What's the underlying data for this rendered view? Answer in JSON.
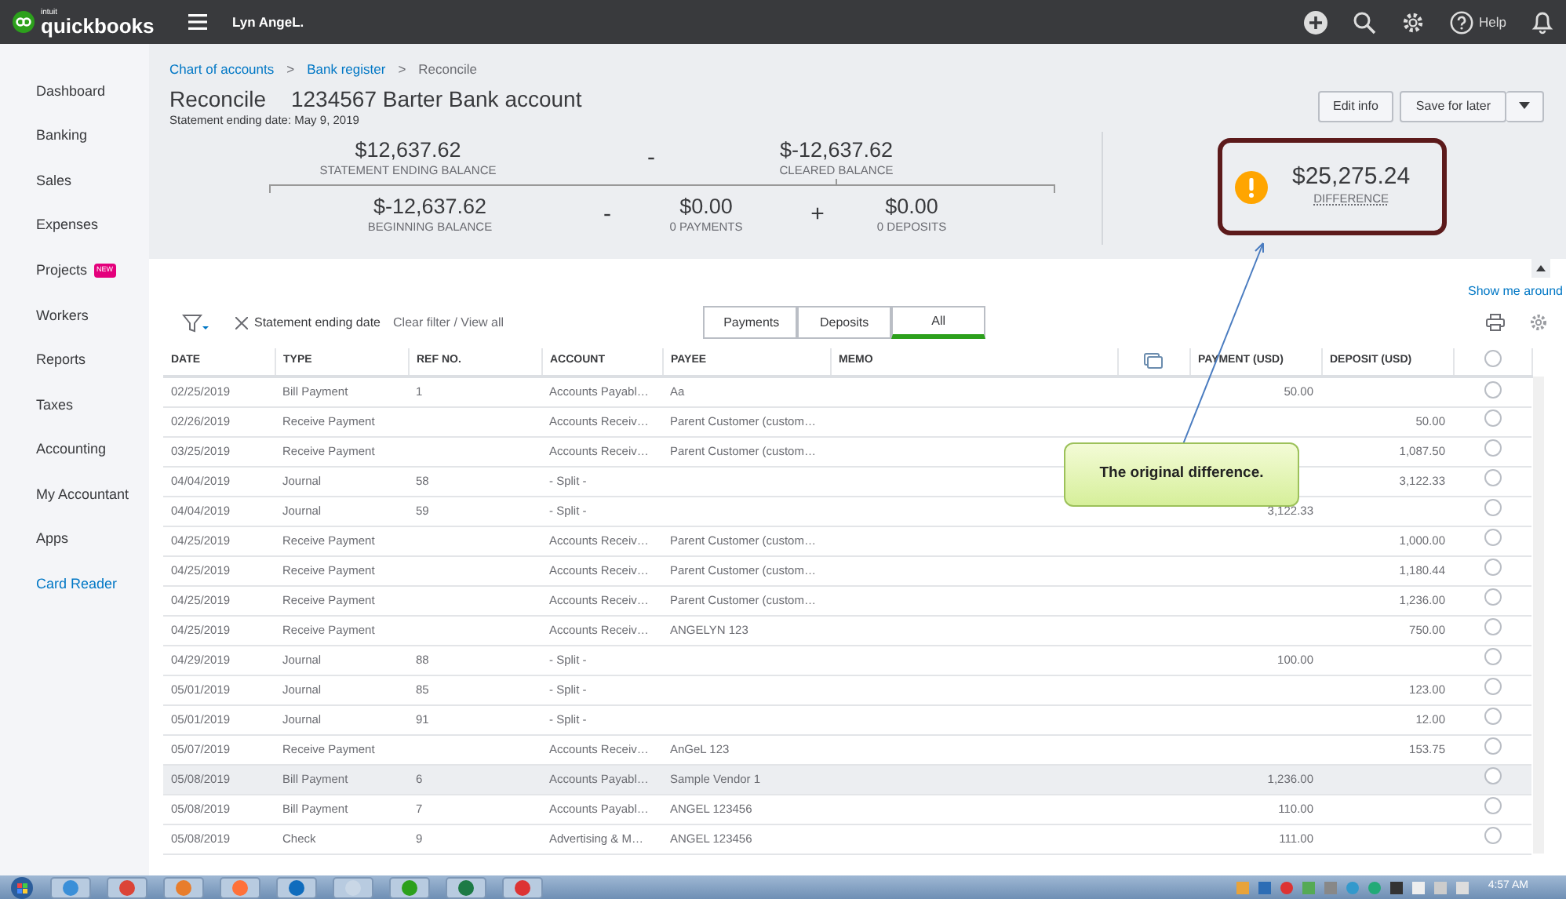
{
  "topbar": {
    "logo_small": "intuit",
    "logo": "quickbooks",
    "company": "Lyn AngeL.",
    "help": "Help"
  },
  "sidebar": {
    "items": [
      {
        "label": "Dashboard",
        "kind": "item"
      },
      {
        "label": "Banking",
        "kind": "item"
      },
      {
        "label": "Sales",
        "kind": "item"
      },
      {
        "label": "Expenses",
        "kind": "item"
      },
      {
        "label": "Projects",
        "kind": "item",
        "badge": "NEW"
      },
      {
        "label": "Workers",
        "kind": "item"
      },
      {
        "label": "Reports",
        "kind": "item"
      },
      {
        "label": "Taxes",
        "kind": "item"
      },
      {
        "label": "Accounting",
        "kind": "item"
      },
      {
        "label": "My Accountant",
        "kind": "item"
      },
      {
        "label": "Apps",
        "kind": "item"
      },
      {
        "label": "Card Reader",
        "kind": "link"
      }
    ]
  },
  "breadcrumb": {
    "separator": ">",
    "items": [
      {
        "label": "Chart of accounts",
        "current": false
      },
      {
        "label": "Bank register",
        "current": false
      },
      {
        "label": "Reconcile",
        "current": true
      }
    ]
  },
  "header": {
    "title": "Reconcile",
    "account": "1234567 Barter Bank account",
    "subtitle": "Statement ending date: May 9, 2019",
    "edit_button": "Edit info",
    "save_button": "Save for later"
  },
  "summary": {
    "statement_ending": {
      "amount": "$12,637.62",
      "label": "STATEMENT ENDING BALANCE"
    },
    "op1": "-",
    "cleared": {
      "amount": "$-12,637.62",
      "label": "CLEARED BALANCE"
    },
    "beginning": {
      "amount": "$-12,637.62",
      "label": "BEGINNING BALANCE"
    },
    "op2": "-",
    "payments": {
      "amount": "$0.00",
      "label": "0 PAYMENTS"
    },
    "op3": "+",
    "deposits": {
      "amount": "$0.00",
      "label": "0 DEPOSITS"
    },
    "difference": {
      "amount": "$25,275.24",
      "label": "DIFFERENCE",
      "warning": true
    }
  },
  "annotation": {
    "text": "The original difference."
  },
  "show_me_around": "Show me around",
  "filter": {
    "chip": "Statement ending date",
    "clear": "Clear filter / View all"
  },
  "view_tabs": [
    {
      "label": "Payments",
      "selected": false
    },
    {
      "label": "Deposits",
      "selected": false
    },
    {
      "label": "All",
      "selected": true
    }
  ],
  "table": {
    "select_all_checked": false,
    "columns": [
      "DATE",
      "TYPE",
      "REF NO.",
      "ACCOUNT",
      "PAYEE",
      "MEMO",
      "PAYMENT (USD)",
      "DEPOSIT (USD)"
    ],
    "rows": [
      {
        "date": "02/25/2019",
        "type": "Bill Payment",
        "ref": "1",
        "account": "Accounts Payabl…",
        "payee": "Aa",
        "payment": "50.00",
        "cleared": false,
        "highlighted": false
      },
      {
        "date": "02/26/2019",
        "type": "Receive Payment",
        "account": "Accounts Receiv…",
        "payee": "Parent Customer (custom…",
        "deposit": "50.00",
        "cleared": false,
        "highlighted": false
      },
      {
        "date": "03/25/2019",
        "type": "Receive Payment",
        "account": "Accounts Receiv…",
        "payee": "Parent Customer (custom…",
        "deposit": "1,087.50",
        "cleared": false,
        "highlighted": false
      },
      {
        "date": "04/04/2019",
        "type": "Journal",
        "ref": "58",
        "account": "- Split -",
        "deposit": "3,122.33",
        "cleared": false,
        "highlighted": false
      },
      {
        "date": "04/04/2019",
        "type": "Journal",
        "ref": "59",
        "account": "- Split -",
        "payment": "3,122.33",
        "cleared": false,
        "highlighted": false
      },
      {
        "date": "04/25/2019",
        "type": "Receive Payment",
        "account": "Accounts Receiv…",
        "payee": "Parent Customer (custom…",
        "deposit": "1,000.00",
        "cleared": false,
        "highlighted": false
      },
      {
        "date": "04/25/2019",
        "type": "Receive Payment",
        "account": "Accounts Receiv…",
        "payee": "Parent Customer (custom…",
        "deposit": "1,180.44",
        "cleared": false,
        "highlighted": false
      },
      {
        "date": "04/25/2019",
        "type": "Receive Payment",
        "account": "Accounts Receiv…",
        "payee": "Parent Customer (custom…",
        "deposit": "1,236.00",
        "cleared": false,
        "highlighted": false
      },
      {
        "date": "04/25/2019",
        "type": "Receive Payment",
        "account": "Accounts Receiv…",
        "payee": "ANGELYN 123",
        "deposit": "750.00",
        "cleared": false,
        "highlighted": false
      },
      {
        "date": "04/29/2019",
        "type": "Journal",
        "ref": "88",
        "account": "- Split -",
        "payment": "100.00",
        "cleared": false,
        "highlighted": false
      },
      {
        "date": "05/01/2019",
        "type": "Journal",
        "ref": "85",
        "account": "- Split -",
        "deposit": "123.00",
        "cleared": false,
        "highlighted": false
      },
      {
        "date": "05/01/2019",
        "type": "Journal",
        "ref": "91",
        "account": "- Split -",
        "deposit": "12.00",
        "cleared": false,
        "highlighted": false
      },
      {
        "date": "05/07/2019",
        "type": "Receive Payment",
        "account": "Accounts Receiv…",
        "payee": "AnGeL 123",
        "deposit": "153.75",
        "cleared": false,
        "highlighted": false
      },
      {
        "date": "05/08/2019",
        "type": "Bill Payment",
        "ref": "6",
        "account": "Accounts Payabl…",
        "payee": "Sample Vendor 1",
        "payment": "1,236.00",
        "cleared": false,
        "highlighted": true
      },
      {
        "date": "05/08/2019",
        "type": "Bill Payment",
        "ref": "7",
        "account": "Accounts Payabl…",
        "payee": "ANGEL 123456",
        "payment": "110.00",
        "cleared": false,
        "highlighted": false
      },
      {
        "date": "05/08/2019",
        "type": "Check",
        "ref": "9",
        "account": "Advertising & M…",
        "payee": "ANGEL 123456",
        "payment": "111.00",
        "cleared": false,
        "highlighted": false
      }
    ]
  },
  "taskbar": {
    "time": "4:57 AM"
  }
}
